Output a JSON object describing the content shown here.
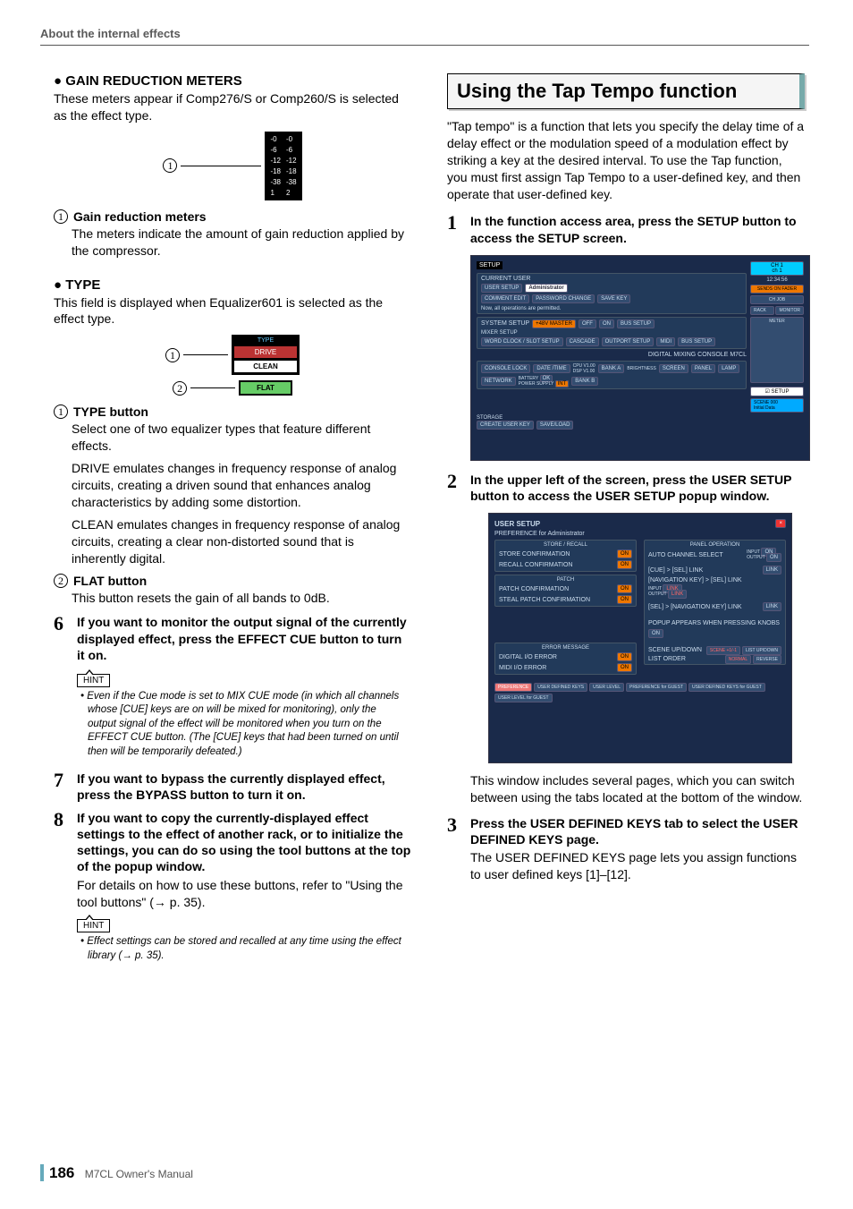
{
  "header": "About the internal effects",
  "left": {
    "gr_heading": "GAIN REDUCTION METERS",
    "gr_intro": "These meters appear if Comp276/S or Comp260/S is selected as the effect type.",
    "gr_fig": {
      "scale": [
        "-0",
        "-6",
        "-12",
        "-18",
        "-38"
      ],
      "cols": [
        "1",
        "2"
      ]
    },
    "gr_callout_title": "Gain reduction meters",
    "gr_callout_body": "The meters indicate the amount of gain reduction applied by the compressor.",
    "type_heading": "TYPE",
    "type_intro": "This field is displayed when Equalizer601 is selected as the effect type.",
    "type_fig": {
      "label": "TYPE",
      "drive": "DRIVE",
      "clean": "CLEAN",
      "flat": "FLAT"
    },
    "type_c1_title": "TYPE button",
    "type_c1_body1": "Select one of two equalizer types that feature different effects.",
    "type_c1_body2": "DRIVE emulates changes in frequency response of analog circuits, creating a driven sound that enhances analog characteristics by adding some distortion.",
    "type_c1_body3": "CLEAN emulates changes in frequency response of analog circuits, creating a clear non-distorted sound that is inherently digital.",
    "type_c2_title": "FLAT button",
    "type_c2_body": "This button resets the gain of all bands to 0dB.",
    "step6": "If you want to monitor the output signal of the currently displayed effect, press the EFFECT CUE button to turn it on.",
    "hint1": "Even if the Cue mode is set to MIX CUE mode (in which all channels whose [CUE] keys are on will be mixed for monitoring), only the output signal of the effect will be monitored when you turn on the EFFECT CUE button. (The [CUE] keys that had been turned on until then will be temporarily defeated.)",
    "step7": "If you want to bypass the currently displayed effect, press the BYPASS button to turn it on.",
    "step8": "If you want to copy the currently-displayed effect settings to the effect of another rack, or to initialize the settings, you can do so using the tool buttons at the top of the popup window.",
    "step8_body": "For details on how to use these buttons, refer to \"Using the tool buttons\" (→ p. 35).",
    "hint2": "Effect settings can be stored and recalled at any time using the effect library (→ p. 35).",
    "hint_label": "HINT"
  },
  "right": {
    "section": "Using the Tap Tempo function",
    "intro": "\"Tap tempo\" is a function that lets you specify the delay time of a delay effect or the modulation speed of a modulation effect by striking a key at the desired interval. To use the Tap function, you must first assign Tap Tempo to a user-defined key, and then operate that user-defined key.",
    "step1": "In the function access area, press the SETUP button to access the SETUP screen.",
    "ss1": {
      "title": "SETUP",
      "ch": "CH 1",
      "ch2": "ch 1",
      "time": "12:34:56",
      "current_user": "CURRENT USER",
      "admin": "Administrator",
      "user_setup": "USER SETUP",
      "comment": "COMMENT EDIT",
      "password": "PASSWORD CHANGE",
      "savekey": "SAVE KEY",
      "perm": "Now, all operations are permitted.",
      "storage": "STORAGE",
      "create": "CREATE USER KEY",
      "saveload": "SAVE/LOAD",
      "sends": "SENDS ON FADER",
      "chjob": "CH JOB",
      "rack": "RACK",
      "monitor": "MONITOR",
      "meter": "METER",
      "system": "SYSTEM SETUP",
      "v48": "+48V MASTER",
      "off": "OFF",
      "on": "ON",
      "bus": "BUS SETUP",
      "mixer": "MIXER SETUP",
      "wc": "WORD CLOCK / SLOT SETUP",
      "cascade": "CASCADE",
      "outport": "OUTPORT SETUP",
      "midi": "MIDI",
      "bussetup": "BUS SETUP",
      "console_model": "DIGITAL MIXING CONSOLE M7CL",
      "console_lock": "CONSOLE LOCK",
      "date": "DATE /TIME",
      "cpu": "CPU",
      "v1": "V1.00",
      "dsp": "DSP",
      "v2": "V1.00",
      "network": "NETWORK",
      "battery": "BATTERY",
      "ok": "OK",
      "power": "POWER SUPPLY",
      "int": "INT",
      "banka": "BANK A",
      "bankb": "BANK B",
      "brightness": "BRIGHTNESS",
      "screen": "SCREEN",
      "panel": "PANEL",
      "lamp": "LAMP",
      "setup_btn": "SETUP",
      "scene": "SCENE 000",
      "initial": "Initial Data"
    },
    "step2": "In the upper left of the screen, press the USER SETUP button to access the USER SETUP popup window.",
    "ss2": {
      "title": "USER SETUP",
      "pref": "PREFERENCE for Administrator",
      "store_recall": "STORE / RECALL",
      "store_conf": "STORE CONFIRMATION",
      "recall_conf": "RECALL CONFIRMATION",
      "patch": "PATCH",
      "patch_conf": "PATCH CONFIRMATION",
      "steal_conf": "STEAL PATCH CONFIRMATION",
      "error": "ERROR MESSAGE",
      "digital_err": "DIGITAL I/O ERROR",
      "midi_err": "MIDI I/O ERROR",
      "panel_op": "PANEL OPERATION",
      "auto_ch": "AUTO CHANNEL SELECT",
      "input": "INPUT",
      "output": "OUTPUT",
      "cue_sel": "[CUE] > [SEL] LINK",
      "nav_sel": "[NAVIGATION KEY] > [SEL] LINK",
      "sel_nav": "[SEL] > [NAVIGATION KEY] LINK",
      "popup": "POPUP APPEARS WHEN PRESSING KNOBS",
      "scene_ud": "SCENE UP/DOWN",
      "scene_pm": "SCENE +1/-1",
      "list_ud": "LIST UP/DOWN",
      "list_order": "LIST ORDER",
      "normal": "NORMAL",
      "reverse": "REVERSE",
      "on": "ON",
      "link": "LINK",
      "tabs": [
        "PREFERENCE",
        "USER DEFINED KEYS",
        "USER LEVEL",
        "PREFERENCE for GUEST",
        "USER DEFINED KEYS for GUEST",
        "USER LEVEL for GUEST"
      ]
    },
    "after_ss2": "This window includes several pages, which you can switch between using the tabs located at the bottom of the window.",
    "step3": "Press the USER DEFINED KEYS tab to select the USER DEFINED KEYS page.",
    "step3_body": "The USER DEFINED KEYS page lets you assign functions to user defined keys [1]–[12]."
  },
  "footer": {
    "page": "186",
    "manual": "M7CL  Owner's Manual"
  }
}
